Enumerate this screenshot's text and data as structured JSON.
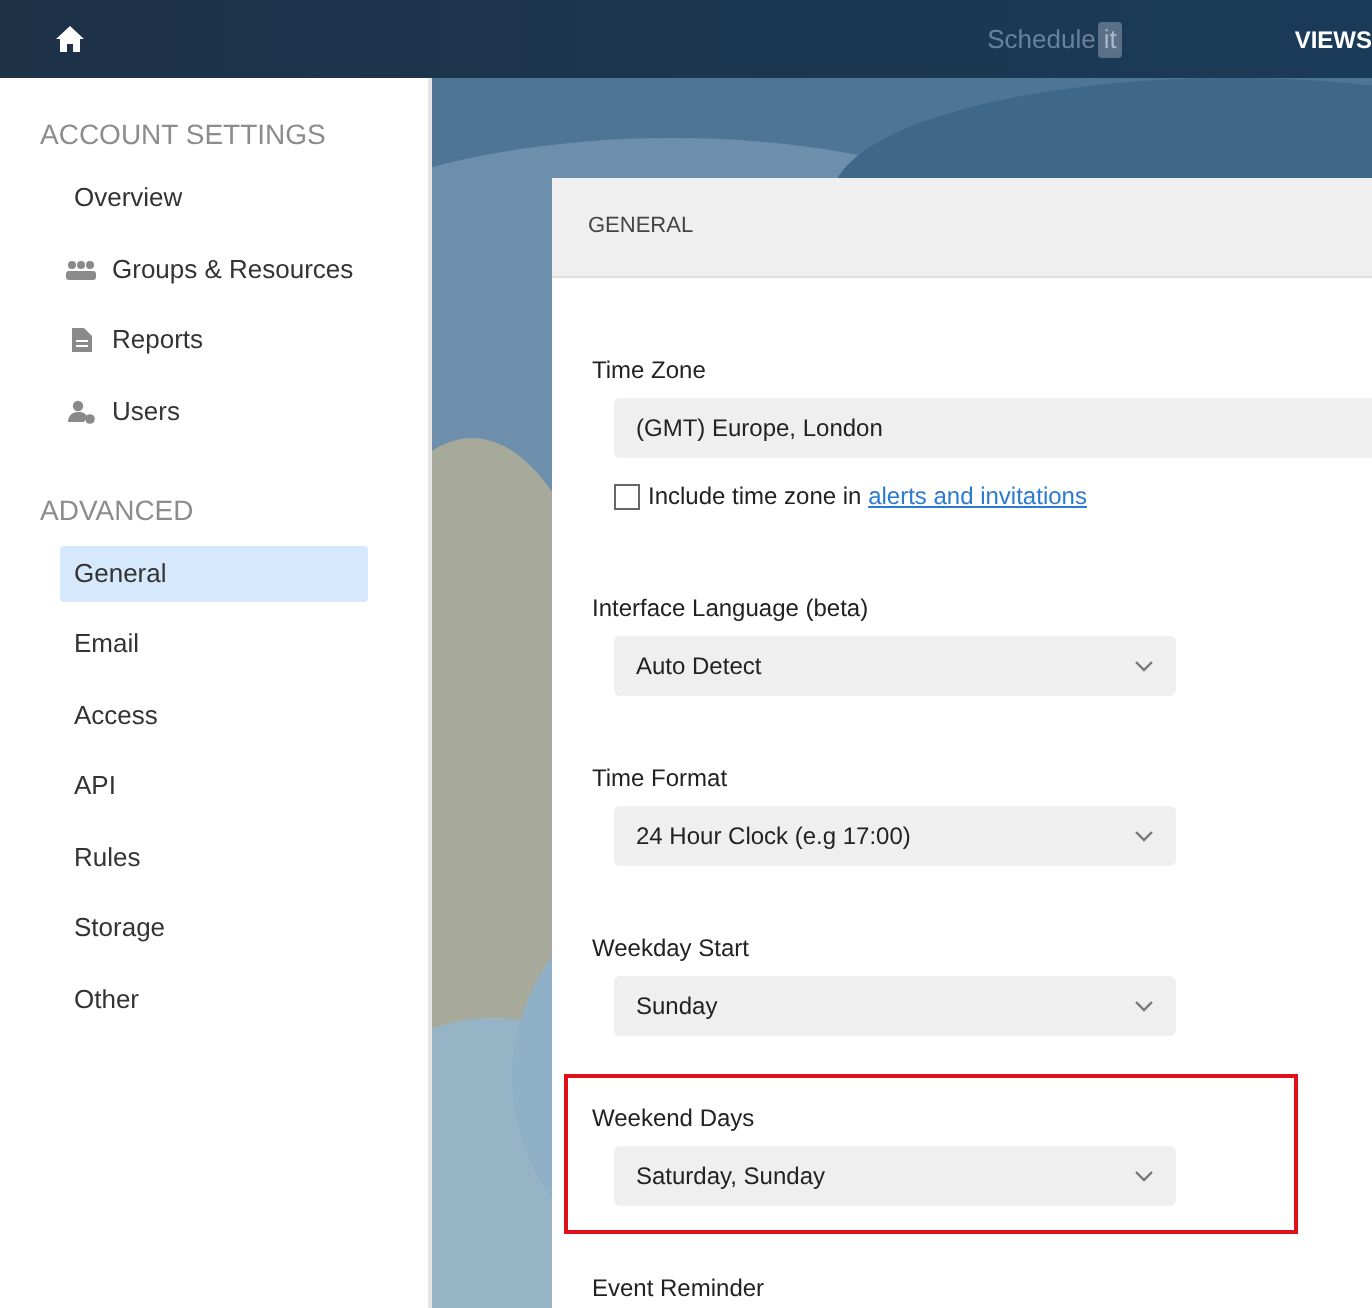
{
  "topbar": {
    "logo_text": "Schedule",
    "logo_badge": "it",
    "menu": "VIEWS"
  },
  "sidebar": {
    "sections": [
      {
        "title": "ACCOUNT SETTINGS",
        "items": [
          {
            "label": "Overview",
            "selected": false
          },
          {
            "label": "Groups & Resources",
            "selected": false
          },
          {
            "label": "Reports",
            "selected": false
          },
          {
            "label": "Users",
            "selected": false
          }
        ]
      },
      {
        "title": "ADVANCED",
        "items": [
          {
            "label": "General",
            "selected": true
          },
          {
            "label": "Email",
            "selected": false
          },
          {
            "label": "Access",
            "selected": false
          },
          {
            "label": "API",
            "selected": false
          },
          {
            "label": "Rules",
            "selected": false
          },
          {
            "label": "Storage",
            "selected": false
          },
          {
            "label": "Other",
            "selected": false
          }
        ]
      }
    ]
  },
  "panel": {
    "title": "GENERAL",
    "fields": [
      {
        "kind": "text",
        "label": "Time Zone",
        "value": "(GMT) Europe, London",
        "highlighted": false,
        "checkbox": {
          "checked": false,
          "text": "Include time zone in ",
          "link": "alerts and invitations"
        }
      },
      {
        "kind": "select",
        "label": "Interface Language (beta)",
        "value": "Auto Detect",
        "highlighted": false
      },
      {
        "kind": "select",
        "label": "Time Format",
        "value": "24 Hour Clock (e.g 17:00)",
        "highlighted": false
      },
      {
        "kind": "select",
        "label": "Weekday Start",
        "value": "Sunday",
        "highlighted": false
      },
      {
        "kind": "select",
        "label": "Weekend Days",
        "value": "Saturday, Sunday",
        "highlighted": true
      },
      {
        "kind": "heading",
        "label": "Event Reminder",
        "highlighted": false
      }
    ]
  }
}
